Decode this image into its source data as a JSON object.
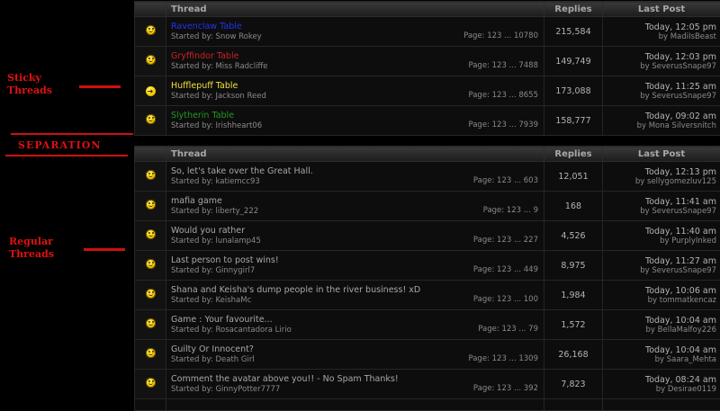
{
  "annotations": {
    "sticky": "Sticky Threads",
    "separation": "SEPARATION",
    "regular": "Regular Threads"
  },
  "headers": {
    "thread": "Thread",
    "replies": "Replies",
    "last_post": "Last Post"
  },
  "sticky_threads": [
    {
      "title": "Ravenclaw Table",
      "title_color": "#2233ee",
      "icon": "smiley-icon",
      "started_by": "Started by: Snow Rokey",
      "pages": "Page: 123 ... 10780",
      "replies": "215,584",
      "time": "Today, 12:05 pm",
      "by": "by MadiIsBeast"
    },
    {
      "title": "Gryffindor Table",
      "title_color": "#cc2222",
      "icon": "smiley-icon",
      "started_by": "Started by: Miss Radcliffe",
      "pages": "Page: 123 ... 7488",
      "replies": "149,749",
      "time": "Today, 12:03 pm",
      "by": "by SeverusSnape97"
    },
    {
      "title": "Hufflepuff Table",
      "title_color": "#f0e040",
      "icon": "arrow-right-icon",
      "started_by": "Started by: Jackson Reed",
      "pages": "Page: 123 ... 8655",
      "replies": "173,088",
      "time": "Today, 11:25 am",
      "by": "by SeverusSnape97"
    },
    {
      "title": "Slytherin Table",
      "title_color": "#229922",
      "icon": "smiley-icon",
      "started_by": "Started by: Irishheart06",
      "pages": "Page: 123 ... 7939",
      "replies": "158,777",
      "time": "Today, 09:02 am",
      "by": "by Mona Silversnitch"
    }
  ],
  "regular_threads": [
    {
      "title": "So, let's take over the Great Hall.",
      "started_by": "Started by: katiemcc93",
      "pages": "Page: 123 ... 603",
      "replies": "12,051",
      "time": "Today, 12:13 pm",
      "by": "by sellygomezluv125"
    },
    {
      "title": "mafia game",
      "started_by": "Started by: liberty_222",
      "pages": "Page: 123 ... 9",
      "replies": "168",
      "time": "Today, 11:41 am",
      "by": "by SeverusSnape97"
    },
    {
      "title": "Would you rather",
      "started_by": "Started by: lunalamp45",
      "pages": "Page: 123 ... 227",
      "replies": "4,526",
      "time": "Today, 11:40 am",
      "by": "by PurplyInked"
    },
    {
      "title": "Last person to post wins!",
      "started_by": "Started by: Ginnygirl7",
      "pages": "Page: 123 ... 449",
      "replies": "8,975",
      "time": "Today, 11:27 am",
      "by": "by SeverusSnape97"
    },
    {
      "title": "Shana and Keisha's dump people in the river business! xD",
      "started_by": "Started by: KeishaMc",
      "pages": "Page: 123 ... 100",
      "replies": "1,984",
      "time": "Today, 10:06 am",
      "by": "by tommatkencaz"
    },
    {
      "title": "Game : Your favourite...",
      "started_by": "Started by: Rosacantadora Lirio",
      "pages": "Page: 123 ... 79",
      "replies": "1,572",
      "time": "Today, 10:04 am",
      "by": "by BellaMalfoy226"
    },
    {
      "title": "Guilty Or Innocent?",
      "started_by": "Started by: Death Girl",
      "pages": "Page: 123 ... 1309",
      "replies": "26,168",
      "time": "Today, 10:04 am",
      "by": "by Saara_Mehta"
    },
    {
      "title": "Comment the avatar above you!! - No Spam Thanks!",
      "started_by": "Started by: GinnyPotter7777",
      "pages": "Page: 123 ... 392",
      "replies": "7,823",
      "time": "Today, 08:24 am",
      "by": "by Desirae0119"
    }
  ],
  "colors": {
    "regular_title": "#a8a8a8",
    "annotation": "#e01010"
  }
}
